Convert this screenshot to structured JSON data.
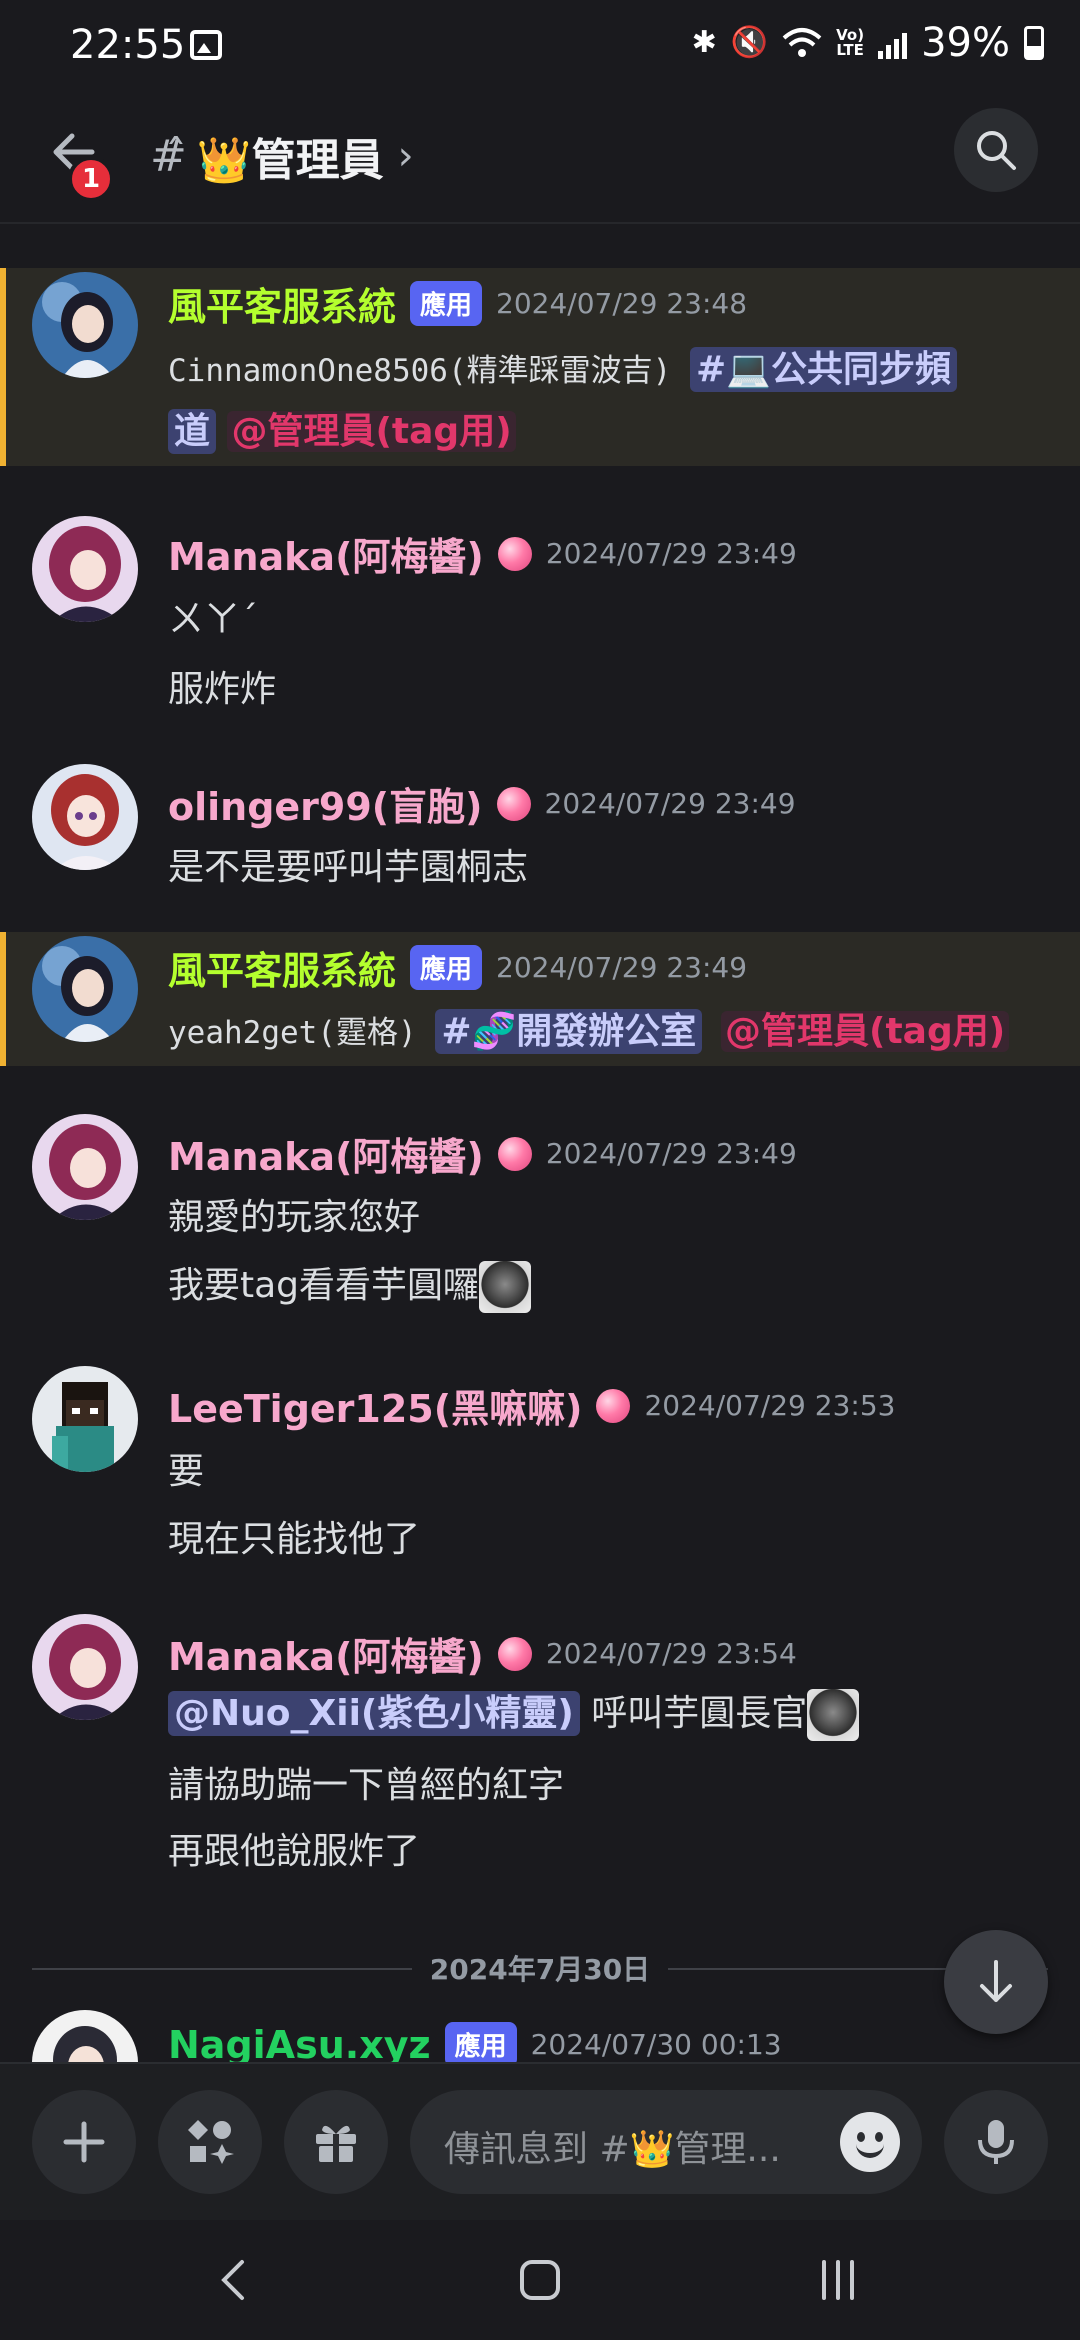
{
  "status_bar": {
    "time": "22:55",
    "battery": "39%",
    "volte_line1": "Vo)",
    "volte_line2": "LTE"
  },
  "header": {
    "notification_badge": "1",
    "channel_name": "👑管理員"
  },
  "messages": [
    {
      "username": "風平客服系統",
      "username_color": "#b4ff2e",
      "app_tag": "應用",
      "timestamp": "2024/07/29 23:48",
      "highlighted": true,
      "line1": {
        "text": "CinnamonOne8506(精準踩雷波吉)",
        "channel_mention": "#💻公共同步頻"
      },
      "line2": {
        "channel_mention_cont": "道",
        "role_mention": "@管理員(tag用)"
      }
    },
    {
      "username": "Manaka(阿梅醬)",
      "username_color": "#f7a8cc",
      "timestamp": "2024/07/29 23:49",
      "lines": [
        "ㄨㄚˊ",
        "服炸炸"
      ]
    },
    {
      "username": "olinger99(盲胞)",
      "username_color": "#f7a8cc",
      "timestamp": "2024/07/29 23:49",
      "lines": [
        "是不是要呼叫芋園桐志"
      ]
    },
    {
      "username": "風平客服系統",
      "username_color": "#b4ff2e",
      "app_tag": "應用",
      "timestamp": "2024/07/29 23:49",
      "highlighted": true,
      "line1": {
        "text": "yeah2get(霆格)",
        "channel_mention": "#🧬開發辦公室",
        "role_mention": "@管理員(tag用)"
      }
    },
    {
      "username": "Manaka(阿梅醬)",
      "username_color": "#f7a8cc",
      "timestamp": "2024/07/29 23:49",
      "lines": [
        "親愛的玩家您好",
        "我要tag看看芋圓囉"
      ]
    },
    {
      "username": "LeeTiger125(黑嘛嘛)",
      "username_color": "#f7a8cc",
      "timestamp": "2024/07/29 23:53",
      "lines": [
        "要",
        "現在只能找他了"
      ]
    },
    {
      "username": "Manaka(阿梅醬)",
      "username_color": "#f7a8cc",
      "timestamp": "2024/07/29 23:54",
      "mention_line": {
        "user_mention": "@Nuo_Xii(紫色小精靈)",
        "text": " 呼叫芋圓長官"
      },
      "lines": [
        "請協助踹一下曾經的紅字",
        "再跟他說服炸了"
      ]
    },
    {
      "username": "NagiAsu.xyz",
      "username_color": "#23d160",
      "app_tag": "應用",
      "timestamp": "2024/07/30 00:13"
    }
  ],
  "date_divider": "2024年7月30日",
  "composer": {
    "placeholder": "傳訊息到 #👑管理..."
  },
  "icons": {
    "back": "arrow-left-icon",
    "search": "search-icon",
    "jump": "arrow-down-icon",
    "add": "plus-icon",
    "apps": "apps-icon",
    "gift": "gift-icon",
    "emoji": "emoji-icon",
    "mic": "mic-icon",
    "gem": "gem-badge-icon"
  }
}
